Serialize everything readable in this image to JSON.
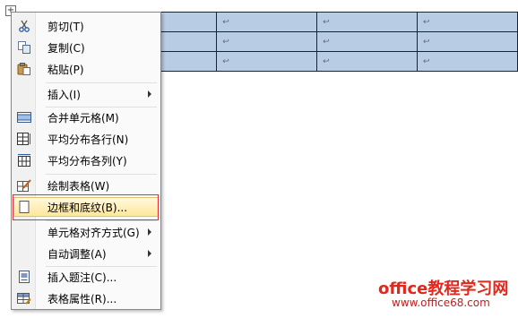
{
  "table": {
    "rows": [
      [
        "",
        "↩",
        "↩",
        "↩",
        "↩"
      ],
      [
        "",
        "↩",
        "↩",
        "↩",
        "↩"
      ],
      [
        "",
        "↩",
        "↩",
        "↩",
        "↩"
      ]
    ]
  },
  "move_handle": "+",
  "menu": {
    "items": [
      {
        "label": "剪切(T)",
        "icon": "scissors-icon"
      },
      {
        "label": "复制(C)",
        "icon": "copy-icon"
      },
      {
        "label": "粘贴(P)",
        "icon": "paste-icon"
      },
      {
        "label": "插入(I)",
        "icon": "",
        "submenu": true
      },
      {
        "label": "合并单元格(M)",
        "icon": "merge-cells-icon"
      },
      {
        "label": "平均分布各行(N)",
        "icon": "distribute-rows-icon"
      },
      {
        "label": "平均分布各列(Y)",
        "icon": "distribute-columns-icon"
      },
      {
        "label": "绘制表格(W)",
        "icon": "draw-table-icon"
      },
      {
        "label": "边框和底纹(B)...",
        "icon": "borders-icon",
        "highlighted": true
      },
      {
        "label": "单元格对齐方式(G)",
        "icon": "",
        "submenu": true
      },
      {
        "label": "自动调整(A)",
        "icon": "",
        "submenu": true
      },
      {
        "label": "插入题注(C)...",
        "icon": "insert-caption-icon"
      },
      {
        "label": "表格属性(R)...",
        "icon": "table-properties-icon"
      }
    ],
    "highlight_border": "#e0303a"
  },
  "watermark": {
    "title": "office教程学习网",
    "url": "www.office68.com"
  }
}
